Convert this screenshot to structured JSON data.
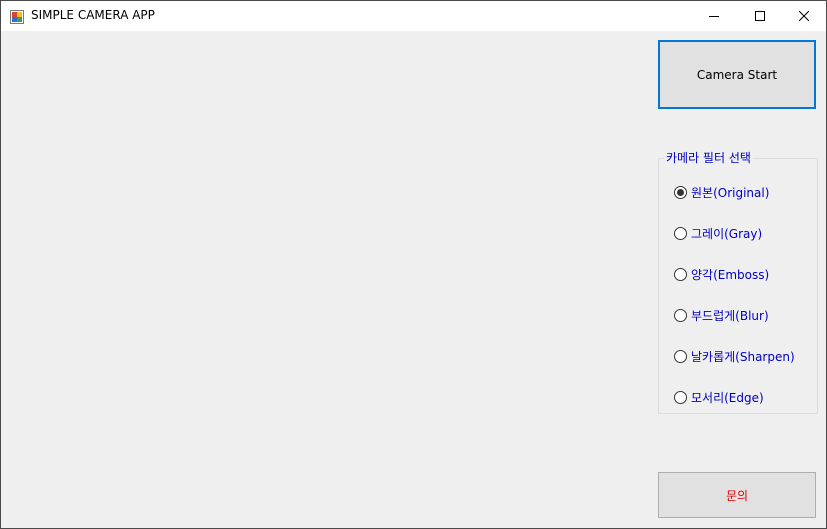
{
  "window": {
    "title": "SIMPLE CAMERA APP",
    "icon": "app-icon",
    "controls": {
      "minimize_icon": "minimize-icon",
      "maximize_icon": "maximize-icon",
      "close_icon": "close-icon"
    }
  },
  "camera_button": {
    "label": "Camera Start"
  },
  "filter_group": {
    "title": "카메라 필터 선택",
    "selected": "원본(Original)",
    "options": [
      {
        "label": "원본(Original)",
        "checked": true
      },
      {
        "label": "그레이(Gray)",
        "checked": false
      },
      {
        "label": "양각(Emboss)",
        "checked": false
      },
      {
        "label": "부드럽게(Blur)",
        "checked": false
      },
      {
        "label": "날카롭게(Sharpen)",
        "checked": false
      },
      {
        "label": "모서리(Edge)",
        "checked": false
      }
    ]
  },
  "inquiry_button": {
    "label": "문의"
  },
  "colors": {
    "accent": "#0078d7",
    "label_text": "#0000c0",
    "inquiry_text": "#e00000",
    "client_bg": "#efefef"
  }
}
